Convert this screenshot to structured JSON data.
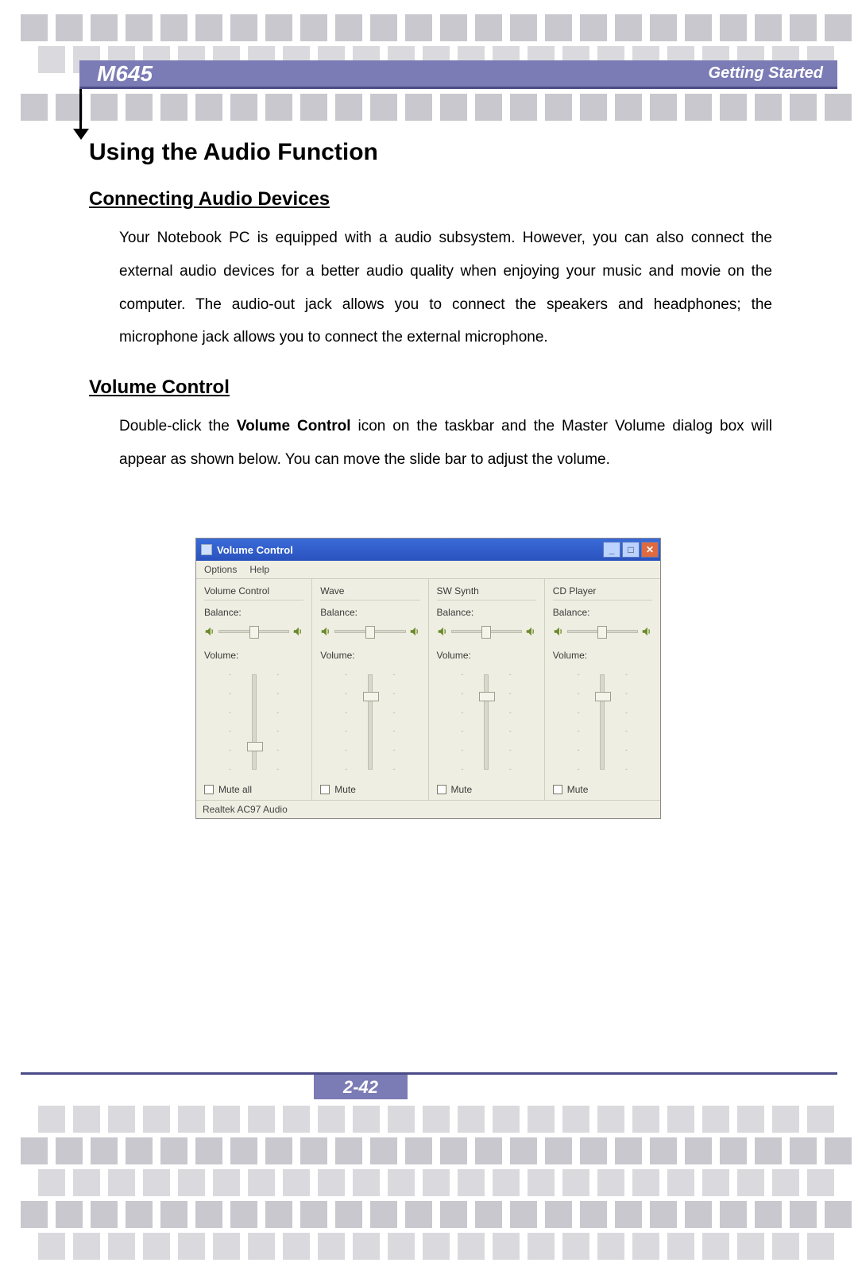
{
  "header": {
    "model": "M645",
    "section": "Getting  Started"
  },
  "headings": {
    "h1": "Using the Audio Function",
    "h2a": "Connecting Audio Devices",
    "h2b": "Volume Control"
  },
  "paragraphs": {
    "p1": "Your Notebook PC is equipped with a audio subsystem.    However, you can also connect the external audio devices for a better audio quality when enjoying your music and movie on the computer.    The audio-out jack allows you to connect the speakers and headphones; the microphone jack allows you to connect the external microphone.",
    "p2_a": "Double-click the ",
    "p2_bold": "Volume Control",
    "p2_b": " icon on the taskbar and the Master Volume dialog box will appear as shown below.  You can move the slide bar to adjust the volume."
  },
  "volume_control": {
    "title": "Volume Control",
    "menu": {
      "options": "Options",
      "help": "Help"
    },
    "labels": {
      "balance": "Balance:",
      "volume": "Volume:"
    },
    "columns": [
      {
        "name": "Volume Control",
        "mute_label": "Mute all",
        "vol_thumb_pct": 72
      },
      {
        "name": "Wave",
        "mute_label": "Mute",
        "vol_thumb_pct": 18
      },
      {
        "name": "SW Synth",
        "mute_label": "Mute",
        "vol_thumb_pct": 18
      },
      {
        "name": "CD Player",
        "mute_label": "Mute",
        "vol_thumb_pct": 18
      }
    ],
    "status": "Realtek AC97 Audio"
  },
  "footer": {
    "page": "2-42"
  }
}
